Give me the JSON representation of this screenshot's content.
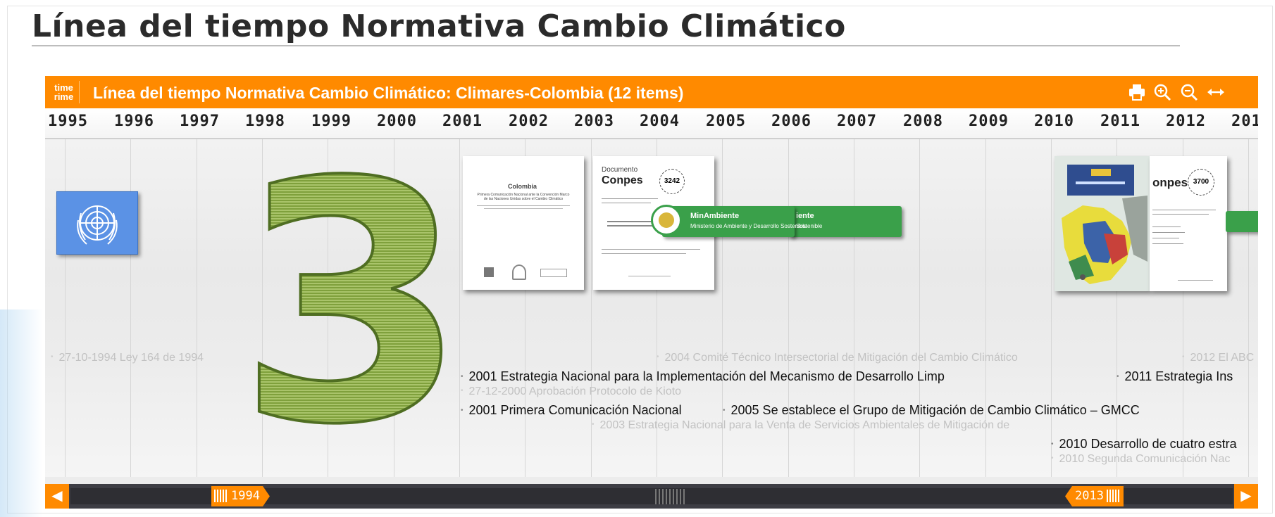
{
  "page": {
    "title": "Línea del tiempo Normativa Cambio Climático"
  },
  "timeline": {
    "logo_line1": "time",
    "logo_line2": "rime",
    "title": "Línea del tiempo Normativa Cambio Climático: Climares-Colombia  (12 items)",
    "years": [
      "1995",
      "1996",
      "1997",
      "1998",
      "1999",
      "2000",
      "2001",
      "2002",
      "2003",
      "2004",
      "2005",
      "2006",
      "2007",
      "2008",
      "2009",
      "2010",
      "2011",
      "2012",
      "201"
    ],
    "big_number": "3",
    "doc1": {
      "title": "Colombia",
      "subtitle": "Primera Comunicación Nacional ante la Convención Marco de las Naciones Unidas sobre el Cambio Climático"
    },
    "doc2": {
      "header": "Documento",
      "brand": "Conpes",
      "number": "3242"
    },
    "doc3": {
      "brand": "onpes",
      "number": "3700"
    },
    "banner1": {
      "title": "MinAmbiente",
      "subtitle": "Ministerio de Ambiente y Desarrollo Sostenible"
    },
    "banner2": {
      "title": "iente",
      "subtitle": "Sostenible"
    },
    "events": [
      {
        "text": "27-10-1994 Ley 164 de 1994",
        "faded": true
      },
      {
        "text": "2004 Comité Técnico Intersectorial de Mitigación del Cambio Climático",
        "faded": true
      },
      {
        "text": "2012 El ABC",
        "faded": true
      },
      {
        "text": "2001 Estrategia Nacional para la Implementación del Mecanismo de Desarrollo Limp",
        "faded": false
      },
      {
        "text": "2011 Estrategia Ins",
        "faded": false
      },
      {
        "text": "27-12-2000 Aprobación Protocolo de Kioto",
        "faded": true
      },
      {
        "text": "2001 Primera Comunicación Nacional",
        "faded": false
      },
      {
        "text": "2005 Se establece el Grupo de Mitigación de Cambio Climático – GMCC",
        "faded": false
      },
      {
        "text": "2003 Estrategia Nacional para la Venta de Servicios Ambientales de Mitigación de",
        "faded": true
      },
      {
        "text": "2010 Desarrollo de cuatro estra",
        "faded": false
      },
      {
        "text": "2010 Segunda Comunicación Nac",
        "faded": true
      }
    ],
    "scroller": {
      "start_label": "1994",
      "end_label": "2013"
    }
  },
  "icons": [
    "print-icon",
    "zoom-in-icon",
    "zoom-out-icon",
    "fit-width-icon",
    "chevron-left-icon",
    "chevron-right-icon"
  ],
  "colors": {
    "accent": "#ff8a00",
    "green": "#3aa04a",
    "un_blue": "#5b92e5"
  }
}
